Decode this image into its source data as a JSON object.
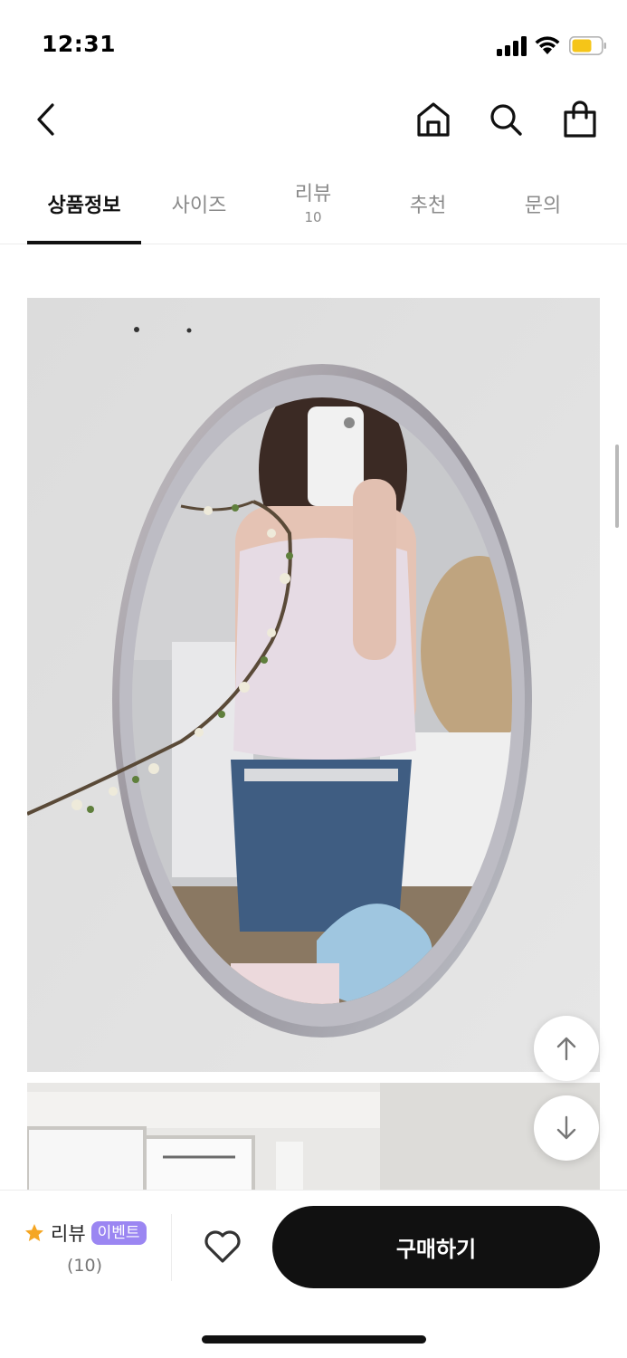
{
  "status_bar": {
    "time": "12:31",
    "icons": [
      "signal-icon",
      "wifi-icon",
      "battery-icon"
    ],
    "battery_color": "#f5c518"
  },
  "header": {
    "icons": [
      "back-arrow-icon",
      "home-icon",
      "search-icon",
      "shopping-bag-icon"
    ]
  },
  "tabs": [
    {
      "label": "상품정보",
      "active": true
    },
    {
      "label": "사이즈",
      "active": false
    },
    {
      "label": "리뷰",
      "count": "10",
      "active": false
    },
    {
      "label": "추천",
      "active": false
    },
    {
      "label": "문의",
      "active": false
    }
  ],
  "content": {
    "images": [
      "product-photo-mirror-selfie",
      "product-photo-room"
    ],
    "float_buttons": [
      "scroll-up-icon",
      "scroll-down-icon"
    ]
  },
  "bottom_bar": {
    "review_label": "리뷰",
    "event_badge": "이벤트",
    "review_count": "(10)",
    "buy_label": "구매하기",
    "accent_color": "#9b86f2",
    "star_color": "#f5a623"
  }
}
